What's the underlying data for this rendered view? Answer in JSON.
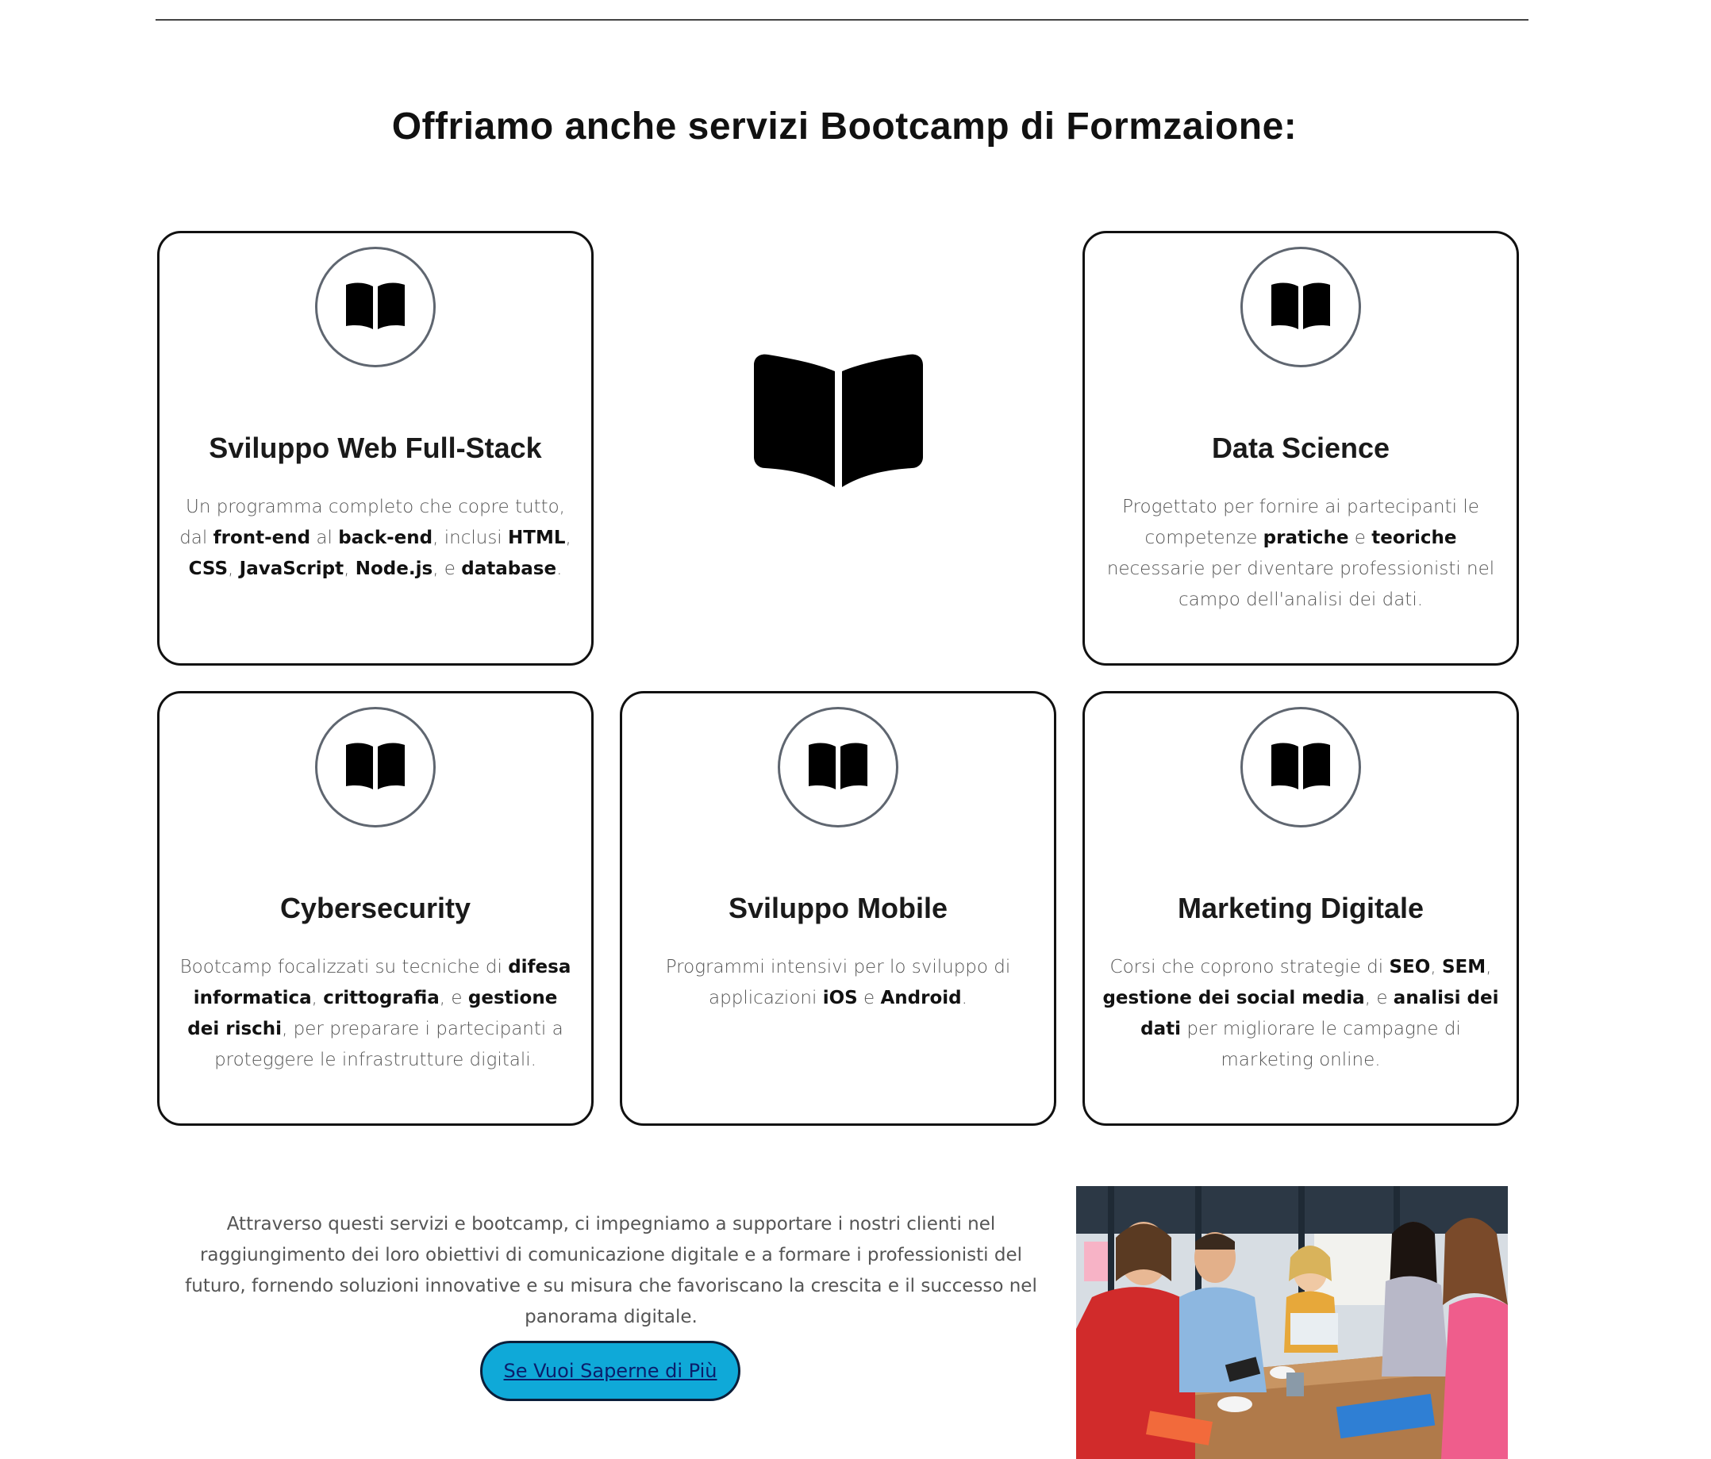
{
  "section": {
    "title": "Offriamo anche servizi Bootcamp di Formzaione:"
  },
  "cards": [
    {
      "title": "Sviluppo Web Full-Stack",
      "desc": [
        {
          "t": "Un programma completo che copre tutto, dal "
        },
        {
          "t": "front-end",
          "b": true
        },
        {
          "t": " al "
        },
        {
          "t": "back-end",
          "b": true
        },
        {
          "t": ", inclusi "
        },
        {
          "t": "HTML",
          "b": true
        },
        {
          "t": ", "
        },
        {
          "t": "CSS",
          "b": true
        },
        {
          "t": ", "
        },
        {
          "t": "JavaScript",
          "b": true
        },
        {
          "t": ", "
        },
        {
          "t": "Node.js",
          "b": true
        },
        {
          "t": ", e "
        },
        {
          "t": "database",
          "b": true
        },
        {
          "t": "."
        }
      ]
    },
    {
      "title": "Data Science",
      "desc": [
        {
          "t": "Progettato per fornire ai partecipanti le competenze "
        },
        {
          "t": "pratiche",
          "b": true
        },
        {
          "t": " e "
        },
        {
          "t": "teoriche",
          "b": true
        },
        {
          "t": " necessarie per diventare professionisti nel campo dell'analisi dei dati."
        }
      ]
    },
    {
      "title": "Cybersecurity",
      "desc": [
        {
          "t": "Bootcamp focalizzati su tecniche di "
        },
        {
          "t": "difesa informatica",
          "b": true
        },
        {
          "t": ", "
        },
        {
          "t": "crittografia",
          "b": true
        },
        {
          "t": ", e "
        },
        {
          "t": "gestione dei rischi",
          "b": true
        },
        {
          "t": ", per preparare i partecipanti a proteggere le infrastrutture digitali."
        }
      ]
    },
    {
      "title": "Sviluppo Mobile",
      "desc": [
        {
          "t": "Programmi intensivi per lo sviluppo di applicazioni "
        },
        {
          "t": "iOS",
          "b": true
        },
        {
          "t": " e "
        },
        {
          "t": "Android",
          "b": true
        },
        {
          "t": "."
        }
      ]
    },
    {
      "title": "Marketing Digitale",
      "desc": [
        {
          "t": "Corsi che coprono strategie di "
        },
        {
          "t": "SEO",
          "b": true
        },
        {
          "t": ", "
        },
        {
          "t": "SEM",
          "b": true
        },
        {
          "t": ", "
        },
        {
          "t": "gestione dei social media",
          "b": true
        },
        {
          "t": ", e "
        },
        {
          "t": "analisi dei dati",
          "b": true
        },
        {
          "t": " per migliorare le campagne di marketing online."
        }
      ]
    }
  ],
  "icons": {
    "card": "book-icon",
    "feature": "book-icon"
  },
  "closing": {
    "text": "Attraverso questi servizi e bootcamp, ci impegniamo a supportare i nostri clienti nel raggiungimento dei loro obiettivi di comunicazione digitale e a formare i professionisti del futuro, fornendo soluzioni innovative e su misura che favoriscano la crescita e il successo nel panorama digitale.",
    "button_label": "Se Vuoi Saperne di Più"
  },
  "photo": {
    "alt_name": "team-meeting-photo"
  },
  "colors": {
    "button_bg": "#0fa9d8",
    "button_border": "#0b1e3a",
    "card_border": "#111111",
    "icon_ring": "#5f6670"
  }
}
